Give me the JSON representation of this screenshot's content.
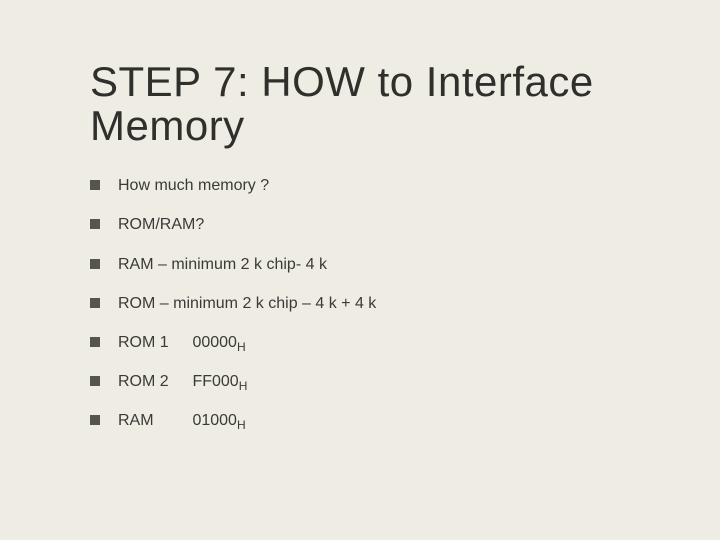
{
  "title": "STEP 7:  HOW  to Interface Memory",
  "bullets": {
    "b0": "How much memory ?",
    "b1": "ROM/RAM?",
    "b2": "RAM – minimum 2 k chip- 4 k",
    "b3": "ROM – minimum 2 k chip – 4 k + 4 k",
    "b4_label": "ROM 1",
    "b4_addr": "00000",
    "b4_sub": "H",
    "b5_label": "ROM 2",
    "b5_addr": "FF000",
    "b5_sub": "H",
    "b6_label": "RAM",
    "b6_addr": "01000",
    "b6_sub": "H"
  }
}
